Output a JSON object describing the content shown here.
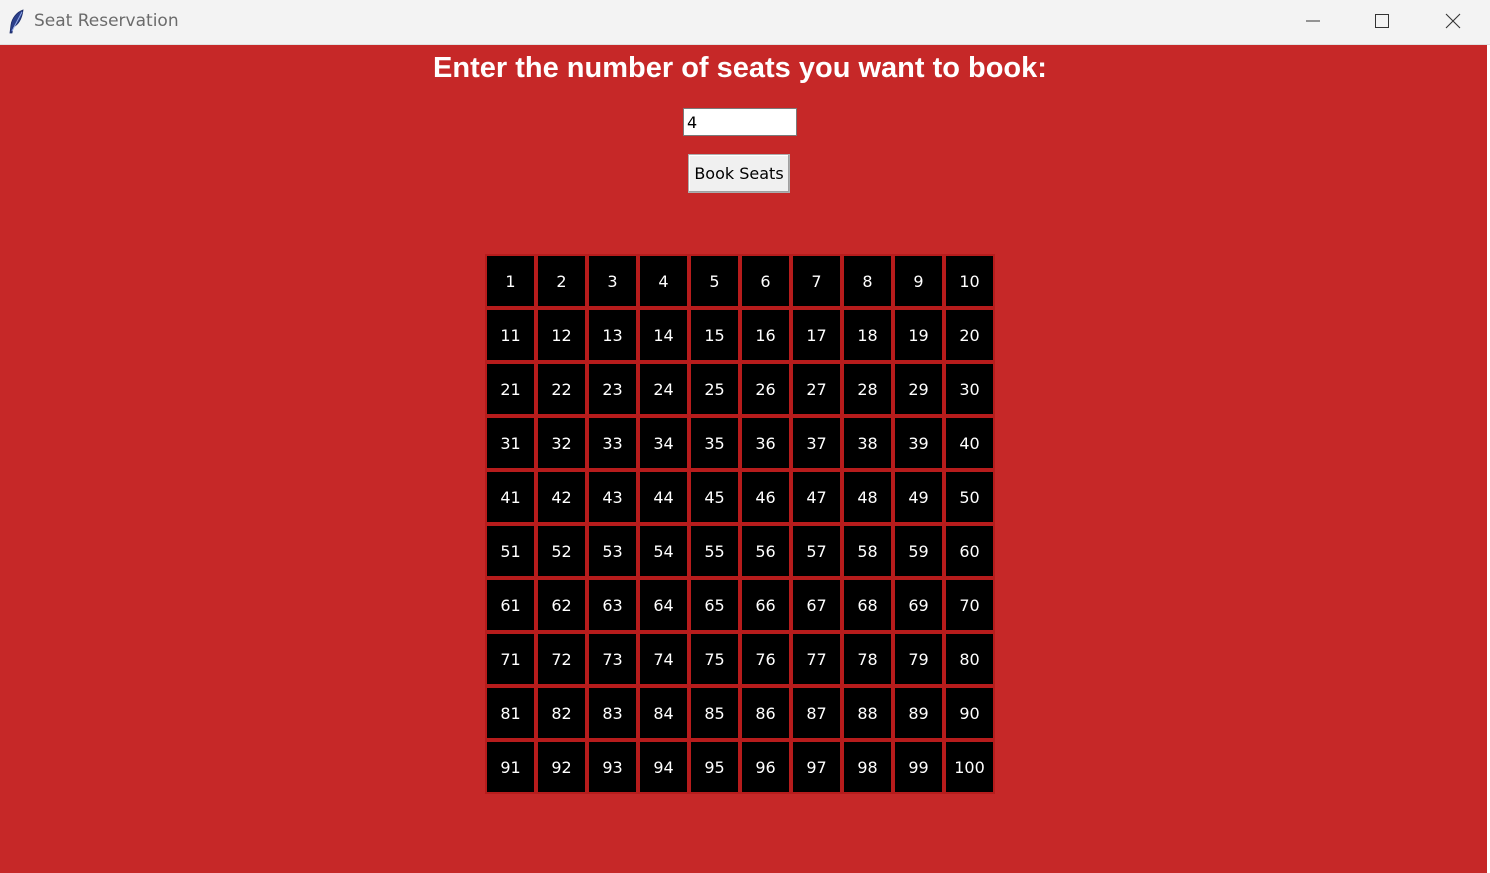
{
  "window": {
    "title": "Seat Reservation",
    "app_icon": "feather-icon",
    "controls": [
      "minimize-icon",
      "maximize-icon",
      "close-icon"
    ]
  },
  "colors": {
    "background": "#c62828",
    "seat": "#000000",
    "seat_text": "#ffffff",
    "seat_border": "#b71c1c"
  },
  "form": {
    "prompt": "Enter the number of seats you want to book:",
    "seat_count_value": "4",
    "book_button_label": "Book Seats"
  },
  "seats": [
    "1",
    "2",
    "3",
    "4",
    "5",
    "6",
    "7",
    "8",
    "9",
    "10",
    "11",
    "12",
    "13",
    "14",
    "15",
    "16",
    "17",
    "18",
    "19",
    "20",
    "21",
    "22",
    "23",
    "24",
    "25",
    "26",
    "27",
    "28",
    "29",
    "30",
    "31",
    "32",
    "33",
    "34",
    "35",
    "36",
    "37",
    "38",
    "39",
    "40",
    "41",
    "42",
    "43",
    "44",
    "45",
    "46",
    "47",
    "48",
    "49",
    "50",
    "51",
    "52",
    "53",
    "54",
    "55",
    "56",
    "57",
    "58",
    "59",
    "60",
    "61",
    "62",
    "63",
    "64",
    "65",
    "66",
    "67",
    "68",
    "69",
    "70",
    "71",
    "72",
    "73",
    "74",
    "75",
    "76",
    "77",
    "78",
    "79",
    "80",
    "81",
    "82",
    "83",
    "84",
    "85",
    "86",
    "87",
    "88",
    "89",
    "90",
    "91",
    "92",
    "93",
    "94",
    "95",
    "96",
    "97",
    "98",
    "99",
    "100"
  ]
}
